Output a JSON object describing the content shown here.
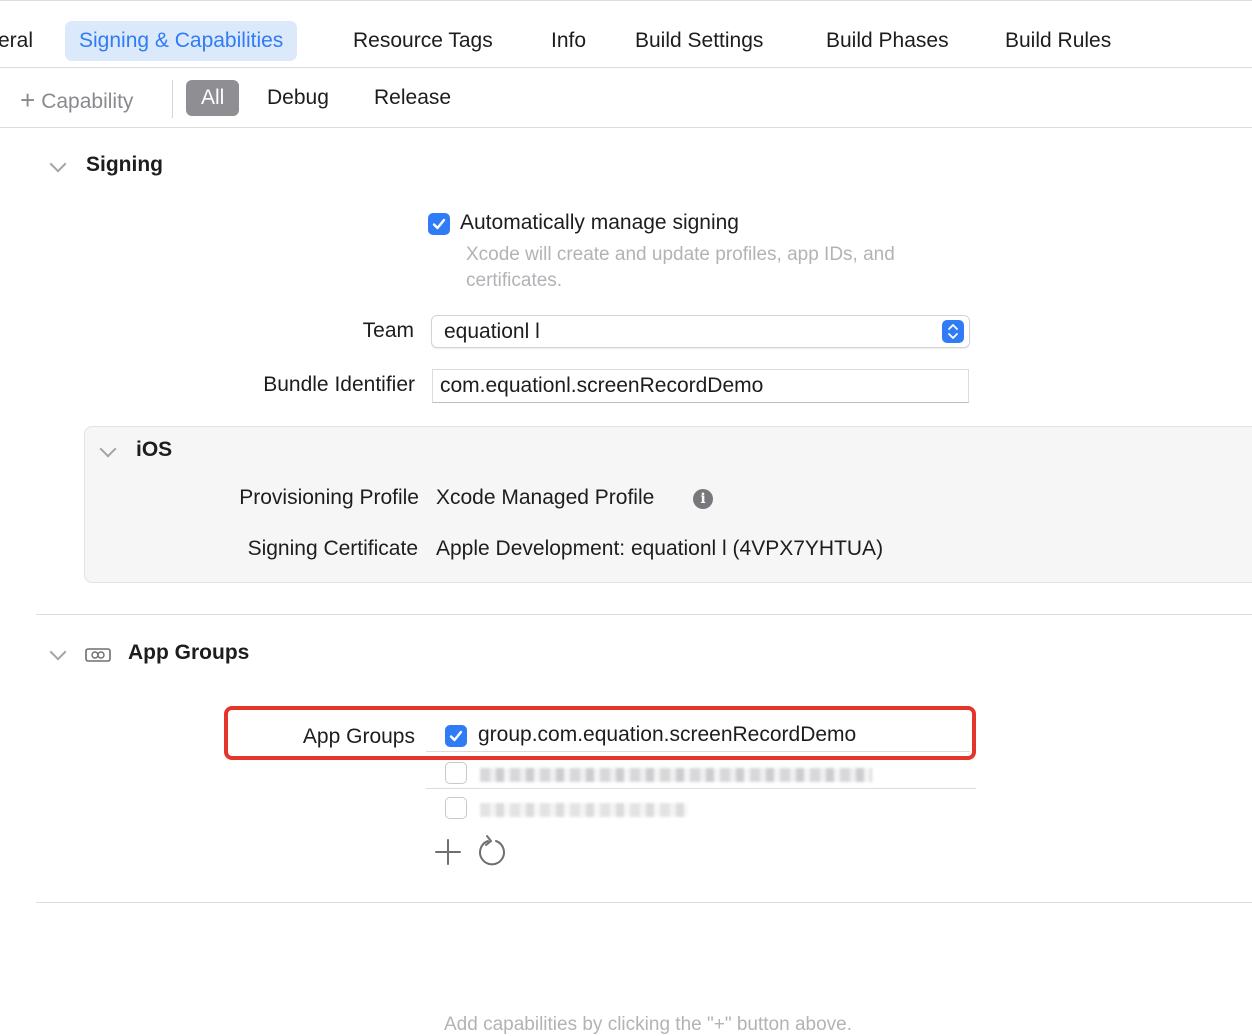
{
  "tabs": [
    {
      "label": "eral",
      "active": false
    },
    {
      "label": "Signing & Capabilities",
      "active": true
    },
    {
      "label": "Resource Tags",
      "active": false
    },
    {
      "label": "Info",
      "active": false
    },
    {
      "label": "Build Settings",
      "active": false
    },
    {
      "label": "Build Phases",
      "active": false
    },
    {
      "label": "Build Rules",
      "active": false
    }
  ],
  "toolbar": {
    "capability_label": "Capability",
    "segments": [
      "All",
      "Debug",
      "Release"
    ],
    "active_segment": "All"
  },
  "signing": {
    "title": "Signing",
    "auto_manage_label": "Automatically manage signing",
    "auto_manage_checked": true,
    "auto_manage_hint_line1": "Xcode will create and update profiles, app IDs, and",
    "auto_manage_hint_line2": "certificates.",
    "team_label": "Team",
    "team_value": "equationl l",
    "bundle_id_label": "Bundle Identifier",
    "bundle_id_value": "com.equationl.screenRecordDemo",
    "ios": {
      "title": "iOS",
      "provisioning_label": "Provisioning Profile",
      "provisioning_value": "Xcode Managed Profile",
      "certificate_label": "Signing Certificate",
      "certificate_value": "Apple Development: equationl l (4VPX7YHTUA)"
    }
  },
  "app_groups": {
    "title": "App Groups",
    "field_label": "App Groups",
    "groups": [
      {
        "id": "group.com.equation.screenRecordDemo",
        "checked": true
      },
      {
        "id": "",
        "checked": false,
        "redacted": true
      },
      {
        "id": "",
        "checked": false,
        "redacted": true
      }
    ]
  },
  "footer_hint": "Add capabilities by clicking the \"+\" button above.",
  "colors": {
    "accent": "#2f7cf6",
    "active_tab_bg": "#dbe9fb",
    "highlight_border": "#e5352b",
    "segment_active_bg": "#8e8e93"
  },
  "icons": {
    "add": "plus-icon",
    "disclosure": "chevron-down-icon",
    "info": "info-icon",
    "app_groups": "app-groups-icon",
    "refresh": "refresh-icon"
  }
}
